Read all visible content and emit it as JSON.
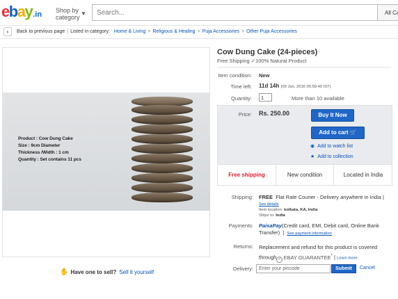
{
  "header": {
    "logo_e": "e",
    "logo_b": "b",
    "logo_a": "a",
    "logo_y": "y",
    "logo_suffix": ".in",
    "shop_by_line1": "Shop by",
    "shop_by_line2": "category",
    "search_placeholder": "Search...",
    "category_select": "All Ca"
  },
  "breadcrumb": {
    "back": "Back to previous page",
    "listed_in": "Listed in category:",
    "items": [
      "Home & Living",
      "Religious & Healing",
      "Puja Accessories",
      "Other Puja Accessories"
    ]
  },
  "image": {
    "caption": [
      "Product : Cow Dung Cake",
      "Size : 9cm Diameter",
      "Thickness /Width : 1 cm",
      "Quantity : Set contains 11 pcs"
    ]
  },
  "sell": {
    "question": "Have one to sell?",
    "link": "Sell it yourself"
  },
  "listing": {
    "title": "Cow Dung Cake (24-pieces)",
    "subtitle": "Free Shipping ✓100% Natural Product",
    "condition_label": "Item condition:",
    "condition_value": "New",
    "time_label": "Time left:",
    "time_value": "11d 14h",
    "time_detail": "(09 Jan, 2016  05:59:40 IST)",
    "qty_label": "Quantity:",
    "qty_value": "1",
    "available": "More than 10 available",
    "price_label": "Price:",
    "price_value": "Rs. 250.00",
    "buy_now": "Buy It Now",
    "add_to_cart": "Add to cart",
    "watch": "Add to watch list",
    "collection": "Add to collection",
    "features": [
      "Free shipping",
      "New condition",
      "Located in India"
    ]
  },
  "shipping": {
    "label": "Shipping:",
    "free": "FREE",
    "text": "Flat Rate Courier - Delivery anywhere in India |",
    "see_details": "See details",
    "location_label": "Item location:",
    "location_value": "kolkata, KA, India",
    "ships_label": "Ships to:",
    "ships_value": "India"
  },
  "payments": {
    "label": "Payments:",
    "brand": "PaisaPay",
    "text_line1": "(Credit card, EMI, Debit card, Online Bank",
    "text_line2": "Transfer)",
    "see_info": "See payment information"
  },
  "returns": {
    "label": "Returns:",
    "line1": "Replacement and refund for this product is covered",
    "through": "through",
    "guarantee": "EBAY GUARANTEE",
    "tm": "*",
    "learn_more": "Learn more"
  },
  "delivery": {
    "label": "Delivery:",
    "placeholder": "Enter your pincode",
    "submit": "Submit",
    "cancel": "Cancel"
  },
  "colors": {
    "ebay_red": "#e53238",
    "ebay_blue": "#0064d2",
    "ebay_yellow": "#f5af02",
    "ebay_green": "#86b817",
    "button_blue": "#1f66c8",
    "link_blue": "#0654ba",
    "free_shipping_red": "#dd1e31"
  }
}
